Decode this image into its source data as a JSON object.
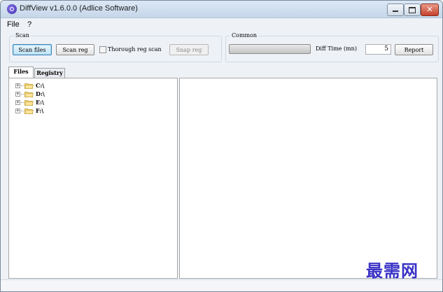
{
  "window": {
    "title": "DiffView v1.6.0.0 (Adlice Software)"
  },
  "menu": {
    "items": [
      "File",
      "?"
    ]
  },
  "scan_group": {
    "label": "Scan",
    "scan_files_label": "Scan files",
    "scan_reg_label": "Scan reg",
    "thorough_label": "Thorough reg scan",
    "thorough_checked": false,
    "snap_reg_label": "Snap reg"
  },
  "common_group": {
    "label": "Common",
    "progress": 0,
    "diff_time_label": "Diff Time (mn)",
    "diff_time_value": "5",
    "report_label": "Report"
  },
  "tabs": [
    {
      "label": "Files",
      "active": true
    },
    {
      "label": "Registry",
      "active": false
    }
  ],
  "tree": {
    "items": [
      {
        "label": "C:\\"
      },
      {
        "label": "D:\\"
      },
      {
        "label": "E:\\"
      },
      {
        "label": "F:\\"
      }
    ]
  },
  "watermark": {
    "text": "最需网"
  },
  "icons": {
    "app": "diffview-app-icon",
    "folder": "folder-icon",
    "expander": "plus-expander-icon"
  }
}
